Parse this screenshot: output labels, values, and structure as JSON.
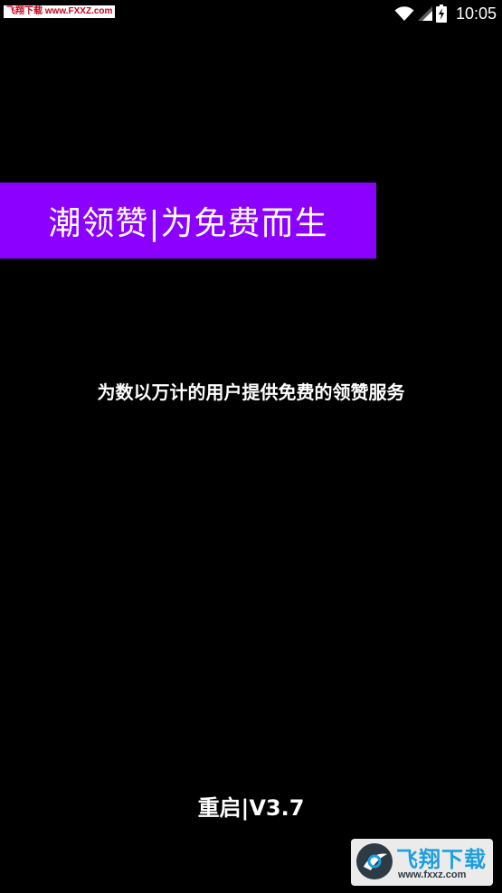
{
  "status_bar": {
    "watermark": "飞翔下载 www.FXXZ.com",
    "time": "10:05",
    "icons": [
      "wifi-icon",
      "cell-signal-icon",
      "battery-charging-icon"
    ]
  },
  "splash": {
    "banner_title": "潮领赞|为免费而生",
    "tagline": "为数以万计的用户提供免费的领赞服务",
    "version": "重启|V3.7"
  },
  "watermark_logo": {
    "name": "飞翔下载",
    "url": "www.fxxz.com"
  },
  "colors": {
    "background": "#000000",
    "banner": "#8b00ff",
    "text": "#ffffff"
  }
}
